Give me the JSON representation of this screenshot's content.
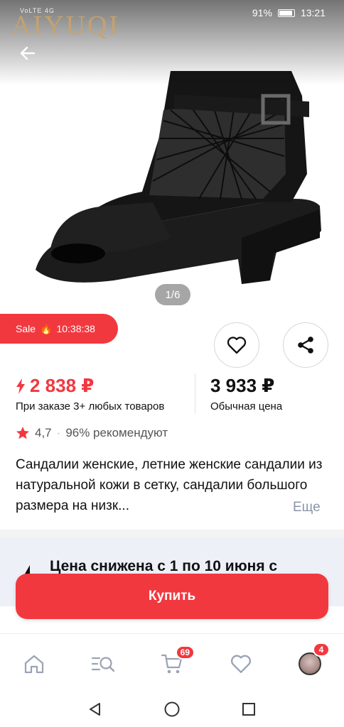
{
  "status": {
    "left_text": "VoLTE 4G",
    "battery": "91%",
    "time": "13:21"
  },
  "brand": "AIYUQI",
  "gallery": {
    "counter": "1/6"
  },
  "sale": {
    "label": "Sale",
    "timer": "10:38:38"
  },
  "prices": {
    "sale_price": "2 838 ₽",
    "sale_note": "При заказе 3+ любых товаров",
    "regular_price": "3 933 ₽",
    "regular_note": "Обычная цена"
  },
  "rating": {
    "value": "4,7",
    "recommend": "96% рекомендуют"
  },
  "description": {
    "text": "Сандалии женские, летние женские сандалии из натуральной кожи в сетку, сандалии большого размера на низк...",
    "more": "Еще"
  },
  "promo": {
    "text": "Цена снижена с 1 по 10 июня с"
  },
  "buy_button": "Купить",
  "nav": {
    "cart_badge": "69",
    "profile_badge": "4"
  },
  "colors": {
    "accent": "#f2383f",
    "muted": "#8b94a7"
  }
}
